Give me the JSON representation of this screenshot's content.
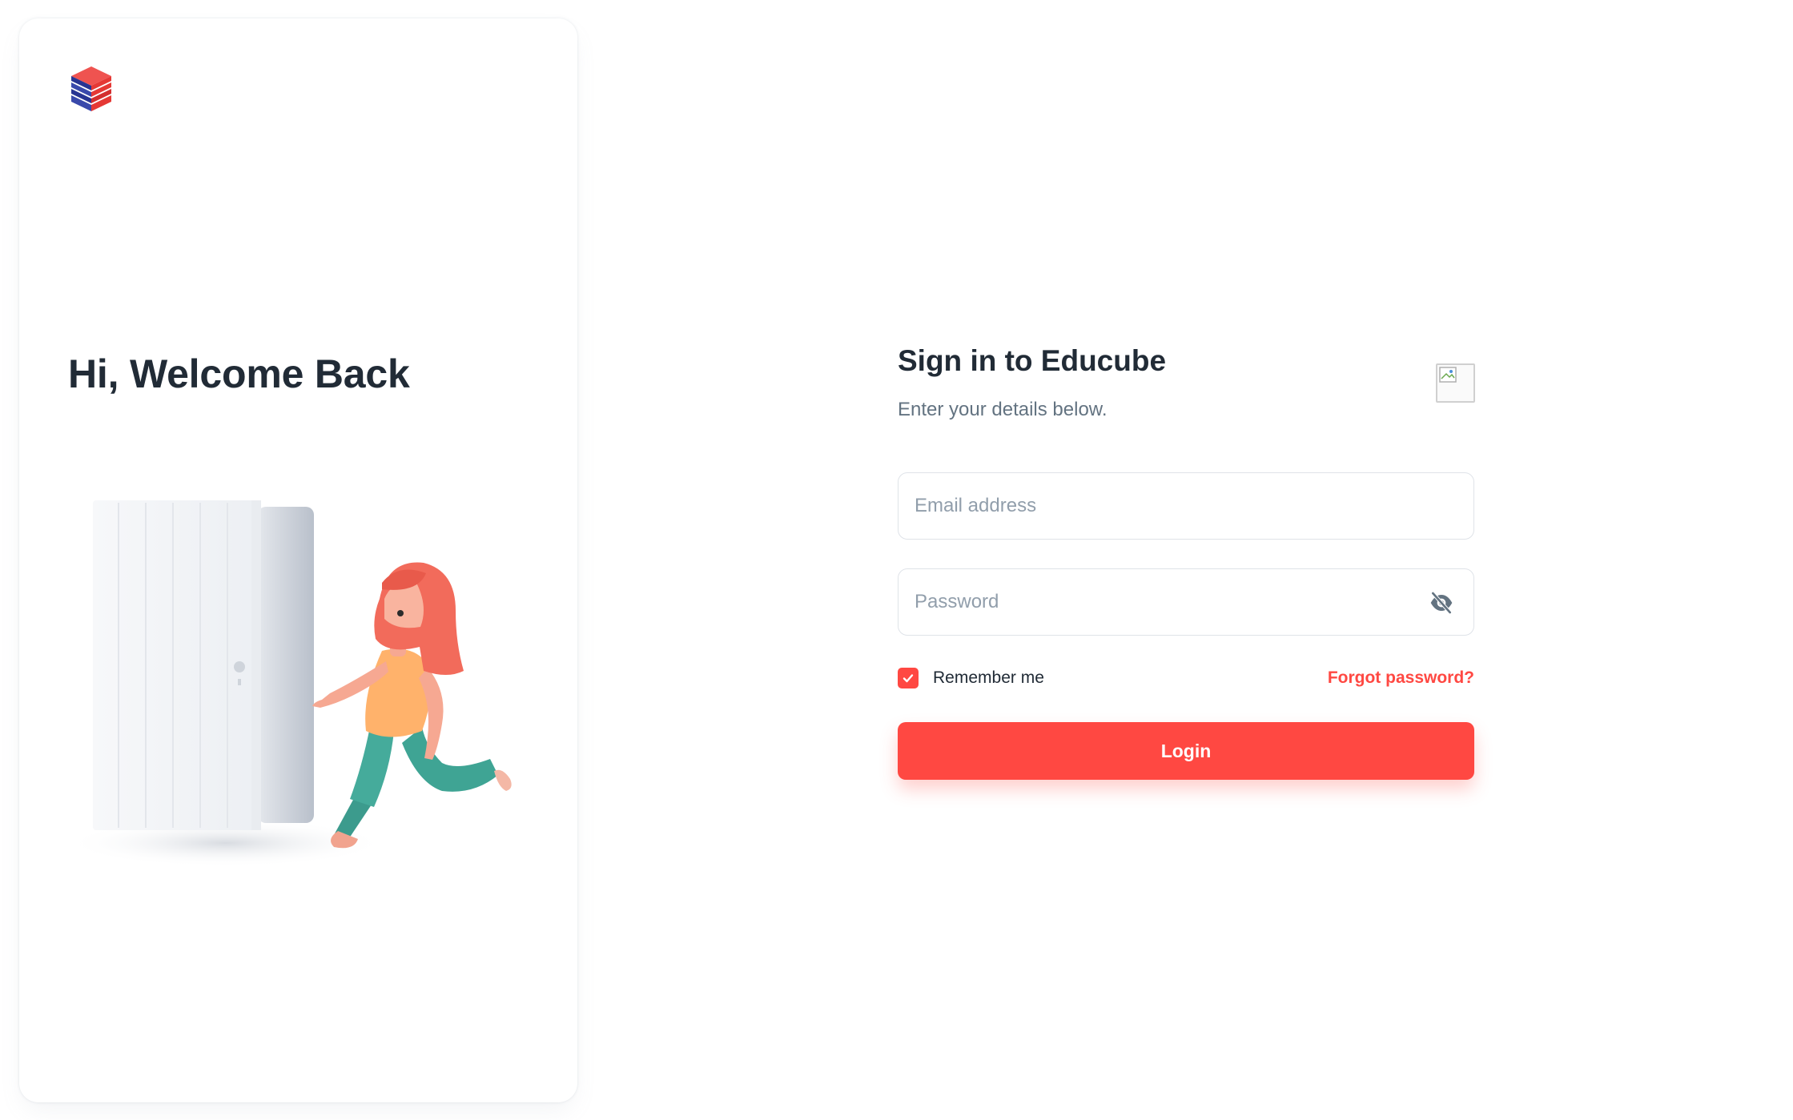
{
  "brand": {
    "logo_icon": "cube-stack-logo-icon",
    "colors": {
      "red": "#e53935",
      "navy": "#283593"
    }
  },
  "left_panel": {
    "heading": "Hi, Welcome Back",
    "illustration": "woman-running-from-door-illustration"
  },
  "signin": {
    "title": "Sign in to Educube",
    "subtitle": "Enter your details below.",
    "broken_image_icon": "broken-image-icon"
  },
  "form": {
    "email_placeholder": "Email address",
    "email_value": "",
    "password_placeholder": "Password",
    "password_value": "",
    "visibility_icon": "eye-off-icon",
    "remember_label": "Remember me",
    "remember_checked": true,
    "forgot_label": "Forgot password?",
    "login_label": "Login"
  },
  "colors": {
    "accent": "#ff4842",
    "text_primary": "#212b36",
    "text_secondary": "#637381",
    "placeholder": "#919eab"
  }
}
